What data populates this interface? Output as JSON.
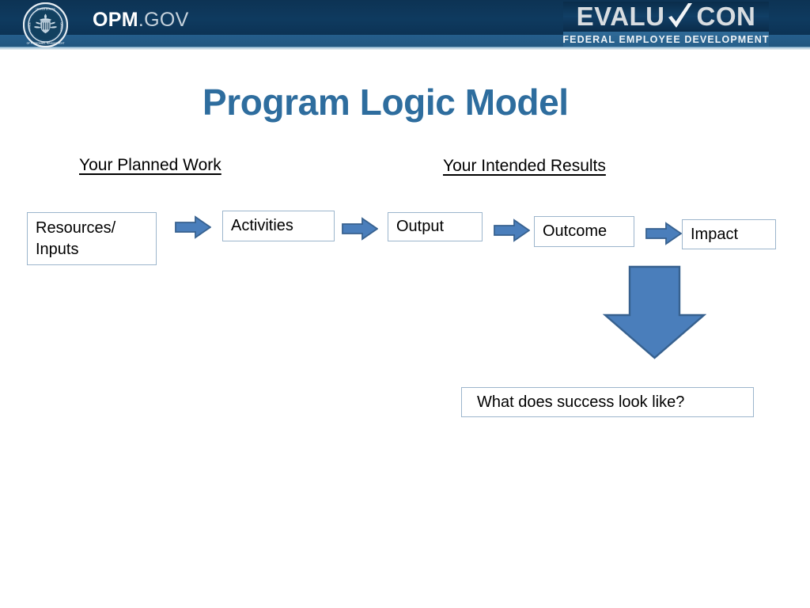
{
  "header": {
    "agency_seal_icon": "opm-seal-icon",
    "wordmark_bold": "OPM",
    "wordmark_light": ".GOV",
    "brand": {
      "part_one": "EVALU",
      "check_icon": "checkmark-icon",
      "part_two": "CON",
      "tagline": "FEDERAL EMPLOYEE DEVELOPMENT"
    },
    "colors": {
      "band_dark": "#0e3a5f",
      "band_mid": "#255e8c",
      "band_light": "#cddde8",
      "brand_plate": "#113f66"
    }
  },
  "slide": {
    "title": "Program Logic Model",
    "title_color": "#2e6d9e",
    "headings": {
      "left": "Your Planned Work",
      "right": "Your Intended Results"
    },
    "flow": {
      "boxes": [
        {
          "id": "resources",
          "label": "Resources/\nInputs",
          "line1": "Resources/",
          "line2": "Inputs"
        },
        {
          "id": "activities",
          "label": "Activities"
        },
        {
          "id": "output",
          "label": "Output"
        },
        {
          "id": "outcome",
          "label": "Outcome"
        },
        {
          "id": "impact",
          "label": "Impact"
        }
      ],
      "arrows": [
        {
          "id": "arrow-1",
          "icon": "arrow-right-icon"
        },
        {
          "id": "arrow-2",
          "icon": "arrow-right-icon"
        },
        {
          "id": "arrow-3",
          "icon": "arrow-right-icon"
        },
        {
          "id": "arrow-4",
          "icon": "arrow-right-icon"
        }
      ],
      "down_arrow": {
        "id": "arrow-down-big",
        "icon": "arrow-down-icon"
      },
      "result_box": {
        "id": "success",
        "label": "What does success look like?"
      },
      "colors": {
        "box_border": "#9cb5cc",
        "box_fill": "#ffffff",
        "arrow_fill": "#4a7ebb",
        "arrow_stroke": "#37618f",
        "text": "#000000"
      }
    }
  }
}
